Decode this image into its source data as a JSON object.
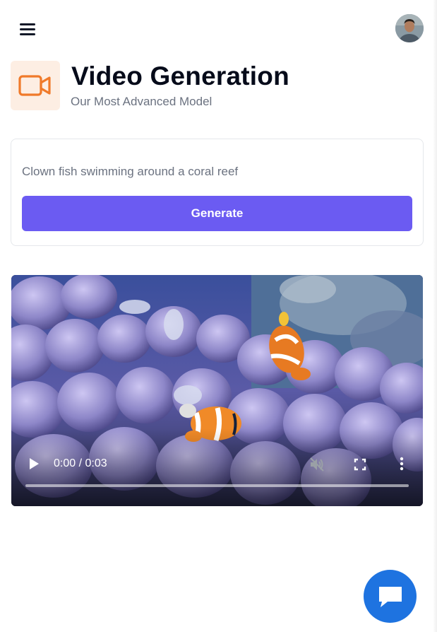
{
  "header": {
    "menu_icon": "hamburger-menu-icon",
    "avatar_icon": "user-avatar"
  },
  "page": {
    "icon": "video-camera-icon",
    "accent_color": "#f07a2a",
    "icon_bg_color": "#fdeee3",
    "title": "Video Generation",
    "subtitle": "Our Most Advanced Model"
  },
  "form": {
    "prompt_value": "Clown fish swimming around a coral reef",
    "prompt_placeholder": "Clown fish swimming around a coral reef",
    "generate_label": "Generate",
    "button_color": "#6b5bf2"
  },
  "video": {
    "current_time": "0:00",
    "duration": "0:03",
    "time_display": "0:00 / 0:03",
    "progress_fraction": 0,
    "icons": [
      "play-icon",
      "volume-muted-icon",
      "fullscreen-icon",
      "more-options-icon"
    ]
  },
  "chat": {
    "icon": "chat-bubble-icon",
    "color": "#1e73e0"
  }
}
